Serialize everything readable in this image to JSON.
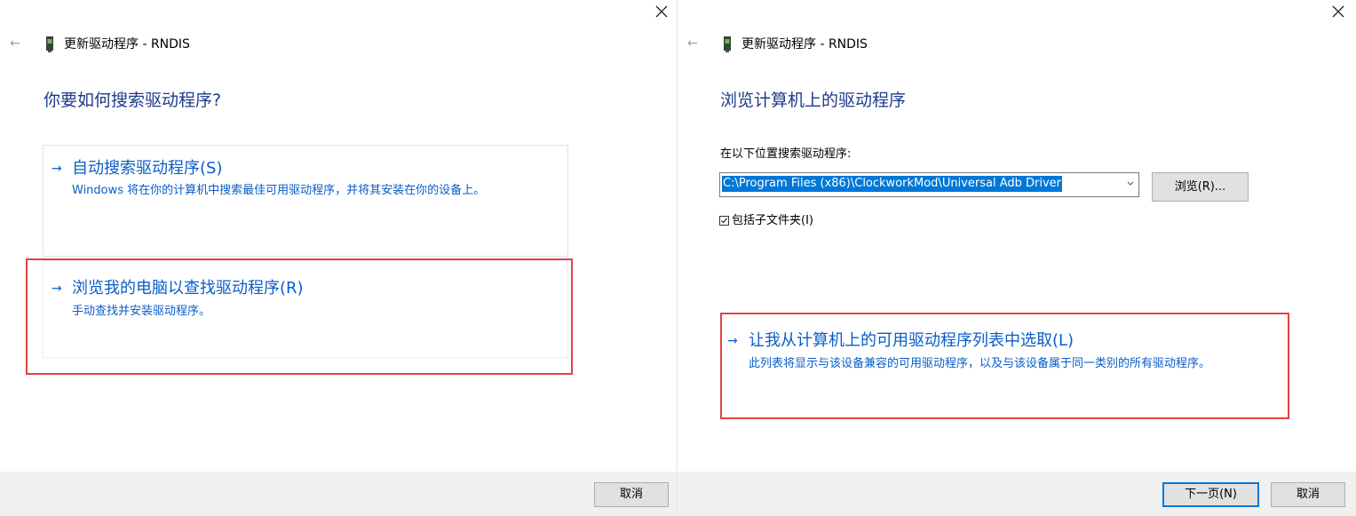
{
  "left_dialog": {
    "title": "更新驱动程序 - RNDIS",
    "heading": "你要如何搜索驱动程序?",
    "options": [
      {
        "title": "自动搜索驱动程序(S)",
        "description": "Windows 将在你的计算机中搜索最佳可用驱动程序，并将其安装在你的设备上。"
      },
      {
        "title": "浏览我的电脑以查找驱动程序(R)",
        "description": "手动查找并安装驱动程序。"
      }
    ],
    "cancel_label": "取消"
  },
  "right_dialog": {
    "title": "更新驱动程序 - RNDIS",
    "heading": "浏览计算机上的驱动程序",
    "search_label": "在以下位置搜索驱动程序:",
    "search_path": "C:\\Program Files (x86)\\ClockworkMod\\Universal Adb Driver",
    "browse_label": "浏览(R)...",
    "include_subfolders_label": "包括子文件夹(I)",
    "include_subfolders_checked": true,
    "pick_option": {
      "title": "让我从计算机上的可用驱动程序列表中选取(L)",
      "description": "此列表将显示与该设备兼容的可用驱动程序，以及与该设备属于同一类别的所有驱动程序。"
    },
    "next_label": "下一页(N)",
    "cancel_label": "取消"
  },
  "icons": {
    "back": "back-arrow-icon",
    "close": "close-icon",
    "device": "device-icon",
    "option_arrow": "arrow-right-icon",
    "dropdown": "chevron-down-icon"
  },
  "colors": {
    "heading": "#1e3b8c",
    "link": "#0a5dc7",
    "highlight_border": "#e14242",
    "selection": "#0078d7",
    "footer": "#f0f0f0"
  }
}
